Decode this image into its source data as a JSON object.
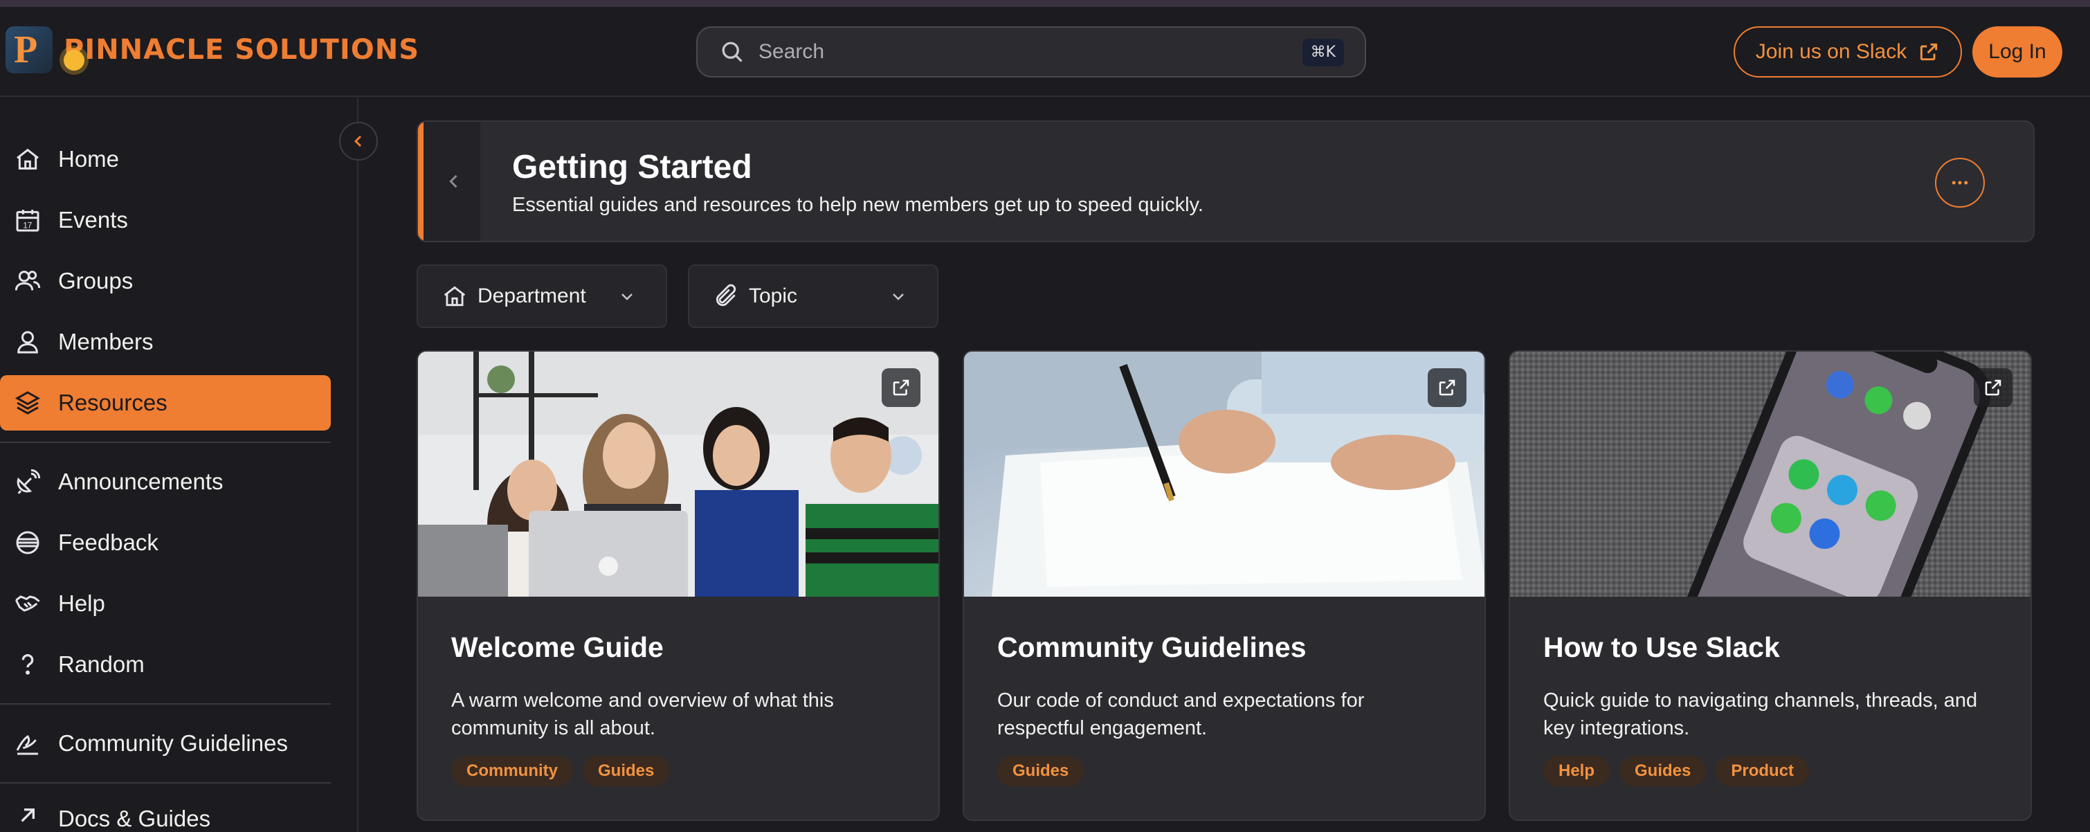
{
  "brand": {
    "name": "PINNACLE SOLUTIONS",
    "mark": "P"
  },
  "search": {
    "placeholder": "Search",
    "shortcut": "⌘K"
  },
  "header": {
    "slack_label": "Join us on Slack",
    "login_label": "Log In"
  },
  "colors": {
    "accent": "#ef7d32",
    "background": "#1c1b1f",
    "card": "#2c2b30"
  },
  "sidebar": {
    "items": [
      {
        "label": "Home",
        "icon": "home-icon"
      },
      {
        "label": "Events",
        "icon": "calendar-icon"
      },
      {
        "label": "Groups",
        "icon": "groups-icon"
      },
      {
        "label": "Members",
        "icon": "member-icon"
      },
      {
        "label": "Resources",
        "icon": "layers-icon",
        "active": true
      },
      {
        "label": "Announcements",
        "icon": "satellite-icon"
      },
      {
        "label": "Feedback",
        "icon": "feedback-icon"
      },
      {
        "label": "Help",
        "icon": "handshake-icon"
      },
      {
        "label": "Random",
        "icon": "question-icon"
      },
      {
        "label": "Community Guidelines",
        "icon": "guidelines-icon"
      },
      {
        "label": "Docs & Guides",
        "icon": "arrow-up-right-icon"
      }
    ]
  },
  "banner": {
    "title": "Getting Started",
    "subtitle": "Essential guides and resources to help new members get up to speed quickly."
  },
  "filters": [
    {
      "label": "Department",
      "icon": "department-icon"
    },
    {
      "label": "Topic",
      "icon": "paperclip-icon"
    }
  ],
  "cards": [
    {
      "title": "Welcome Guide",
      "description": "A warm welcome and overview of what this community is all about.",
      "tags": [
        "Community",
        "Guides"
      ],
      "image": "team-laptop-photo"
    },
    {
      "title": "Community Guidelines",
      "description": "Our code of conduct and expectations for respectful engagement.",
      "tags": [
        "Guides"
      ],
      "image": "signing-document-photo"
    },
    {
      "title": "How to Use Slack",
      "description": "Quick guide to navigating channels, threads, and key integrations.",
      "tags": [
        "Help",
        "Guides",
        "Product"
      ],
      "image": "phone-apps-photo"
    }
  ]
}
